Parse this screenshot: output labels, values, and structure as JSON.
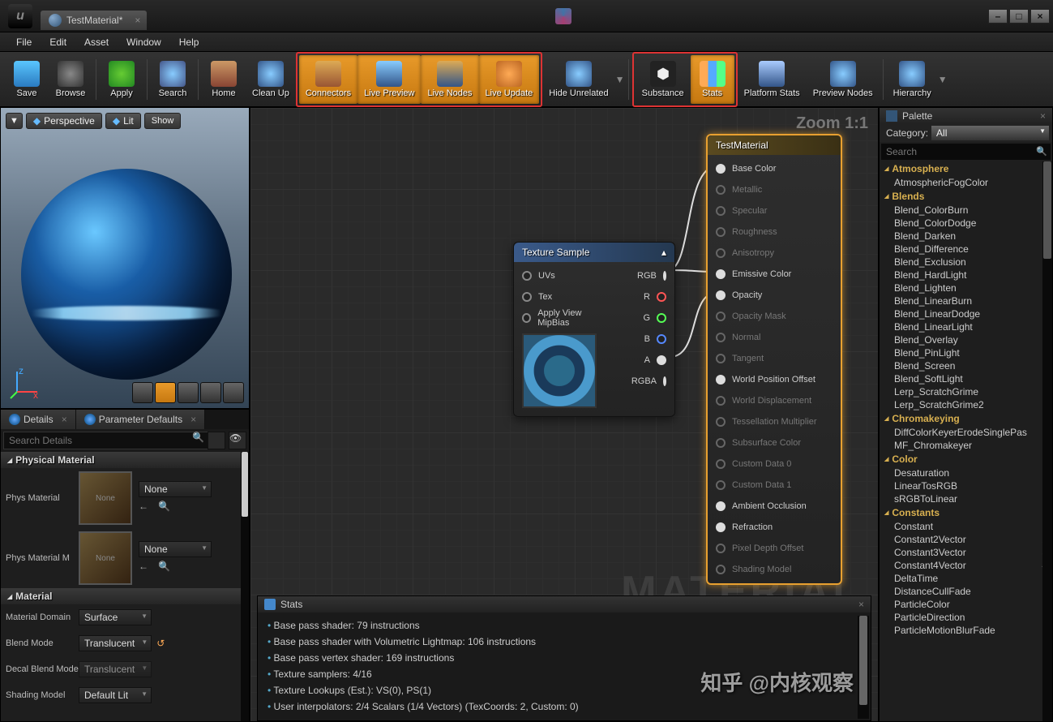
{
  "titlebar": {
    "tab": "TestMaterial*"
  },
  "menu": {
    "file": "File",
    "edit": "Edit",
    "asset": "Asset",
    "window": "Window",
    "help": "Help"
  },
  "toolbar": {
    "save": "Save",
    "browse": "Browse",
    "apply": "Apply",
    "search": "Search",
    "home": "Home",
    "cleanup": "Clean Up",
    "connectors": "Connectors",
    "livepreview": "Live Preview",
    "livenodes": "Live Nodes",
    "liveupdate": "Live Update",
    "hideunrelated": "Hide Unrelated",
    "substance": "Substance",
    "stats": "Stats",
    "platformstats": "Platform Stats",
    "previewnodes": "Preview Nodes",
    "hierarchy": "Hierarchy"
  },
  "viewport": {
    "persp": "Perspective",
    "lit": "Lit",
    "show": "Show"
  },
  "panels": {
    "details": "Details",
    "paramdefaults": "Parameter Defaults"
  },
  "details": {
    "searchPlaceholder": "Search Details",
    "physHeader": "Physical Material",
    "physMat": "Phys Material",
    "physMatM": "Phys Material M",
    "none": "None",
    "matHeader": "Material",
    "matDomain": "Material Domain",
    "matDomainV": "Surface",
    "blendMode": "Blend Mode",
    "blendModeV": "Translucent",
    "decalBlend": "Decal Blend Mode",
    "decalBlendV": "Translucent",
    "shadingModel": "Shading Model",
    "shadingModelV": "Default Lit"
  },
  "graph": {
    "zoom": "Zoom 1:1",
    "watermark": "MATERIAL",
    "texNode": {
      "title": "Texture Sample",
      "uvs": "UVs",
      "tex": "Tex",
      "mip": "Apply View MipBias",
      "rgb": "RGB",
      "r": "R",
      "g": "G",
      "b": "B",
      "a": "A",
      "rgba": "RGBA"
    },
    "result": {
      "title": "TestMaterial",
      "pins": [
        {
          "label": "Base Color",
          "active": true
        },
        {
          "label": "Metallic",
          "active": false,
          "dim": true
        },
        {
          "label": "Specular",
          "active": false,
          "dim": true
        },
        {
          "label": "Roughness",
          "active": false,
          "dim": true
        },
        {
          "label": "Anisotropy",
          "active": false,
          "dim": true
        },
        {
          "label": "Emissive Color",
          "active": true
        },
        {
          "label": "Opacity",
          "active": true
        },
        {
          "label": "Opacity Mask",
          "active": false,
          "dim": true
        },
        {
          "label": "Normal",
          "active": false,
          "dim": true
        },
        {
          "label": "Tangent",
          "active": false,
          "dim": true
        },
        {
          "label": "World Position Offset",
          "active": true
        },
        {
          "label": "World Displacement",
          "active": false,
          "dim": true
        },
        {
          "label": "Tessellation Multiplier",
          "active": false,
          "dim": true
        },
        {
          "label": "Subsurface Color",
          "active": false,
          "dim": true
        },
        {
          "label": "Custom Data 0",
          "active": false,
          "dim": true
        },
        {
          "label": "Custom Data 1",
          "active": false,
          "dim": true
        },
        {
          "label": "Ambient Occlusion",
          "active": true
        },
        {
          "label": "Refraction",
          "active": true
        },
        {
          "label": "Pixel Depth Offset",
          "active": false,
          "dim": true
        },
        {
          "label": "Shading Model",
          "active": false,
          "dim": true
        }
      ]
    }
  },
  "stats": {
    "title": "Stats",
    "lines": [
      "Base pass shader: 79 instructions",
      "Base pass shader with Volumetric Lightmap: 106 instructions",
      "Base pass vertex shader: 169 instructions",
      "Texture samplers: 4/16",
      "Texture Lookups (Est.): VS(0), PS(1)",
      "User interpolators: 2/4 Scalars (1/4 Vectors) (TexCoords: 2, Custom: 0)"
    ]
  },
  "palette": {
    "title": "Palette",
    "catLabel": "Category:",
    "catAll": "All",
    "searchPlaceholder": "Search",
    "groups": [
      {
        "name": "Atmosphere",
        "items": [
          {
            "n": "AtmosphericFogColor"
          }
        ]
      },
      {
        "name": "Blends",
        "items": [
          {
            "n": "Blend_ColorBurn"
          },
          {
            "n": "Blend_ColorDodge"
          },
          {
            "n": "Blend_Darken"
          },
          {
            "n": "Blend_Difference"
          },
          {
            "n": "Blend_Exclusion"
          },
          {
            "n": "Blend_HardLight"
          },
          {
            "n": "Blend_Lighten"
          },
          {
            "n": "Blend_LinearBurn"
          },
          {
            "n": "Blend_LinearDodge"
          },
          {
            "n": "Blend_LinearLight"
          },
          {
            "n": "Blend_Overlay"
          },
          {
            "n": "Blend_PinLight"
          },
          {
            "n": "Blend_Screen"
          },
          {
            "n": "Blend_SoftLight"
          },
          {
            "n": "Lerp_ScratchGrime"
          },
          {
            "n": "Lerp_ScratchGrime2"
          }
        ]
      },
      {
        "name": "Chromakeying",
        "items": [
          {
            "n": "DiffColorKeyerErodeSinglePas"
          },
          {
            "n": "MF_Chromakeyer"
          }
        ]
      },
      {
        "name": "Color",
        "items": [
          {
            "n": "Desaturation"
          },
          {
            "n": "LinearTosRGB"
          },
          {
            "n": "sRGBToLinear"
          }
        ]
      },
      {
        "name": "Constants",
        "items": [
          {
            "n": "Constant",
            "k": "1"
          },
          {
            "n": "Constant2Vector",
            "k": "2"
          },
          {
            "n": "Constant3Vector",
            "k": "3"
          },
          {
            "n": "Constant4Vector",
            "k": "4"
          },
          {
            "n": "DeltaTime"
          },
          {
            "n": "DistanceCullFade"
          },
          {
            "n": "ParticleColor"
          },
          {
            "n": "ParticleDirection"
          },
          {
            "n": "ParticleMotionBlurFade"
          }
        ]
      }
    ]
  },
  "zhihu": "知乎 @内核观察"
}
